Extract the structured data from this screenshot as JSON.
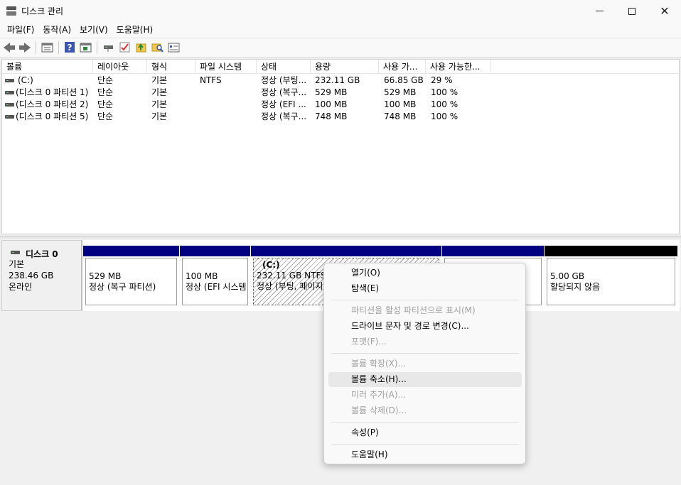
{
  "window": {
    "title": "디스크 관리"
  },
  "menu": [
    "파일(F)",
    "동작(A)",
    "보기(V)",
    "도움말(H)"
  ],
  "toolbar_icons": [
    "back-icon",
    "forward-icon",
    "properties-list-icon",
    "help-icon",
    "volume-view-icon",
    "connect-icon",
    "check-icon",
    "refresh-icon",
    "search-folder-icon",
    "settings-list-icon"
  ],
  "columns": [
    "볼륨",
    "레이아웃",
    "형식",
    "파일 시스템",
    "상태",
    "용량",
    "사용 가...",
    "사용 가능한..."
  ],
  "volumes": [
    {
      "name": "(C:)",
      "layout": "단순",
      "type": "기본",
      "fs": "NTFS",
      "status": "정상 (부팅...",
      "capacity": "232.11 GB",
      "free": "66.85 GB",
      "pct": "29 %"
    },
    {
      "name": "(디스크 0 파티션 1)",
      "layout": "단순",
      "type": "기본",
      "fs": "",
      "status": "정상 (복구...",
      "capacity": "529 MB",
      "free": "529 MB",
      "pct": "100 %"
    },
    {
      "name": "(디스크 0 파티션 2)",
      "layout": "단순",
      "type": "기본",
      "fs": "",
      "status": "정상 (EFI ...",
      "capacity": "100 MB",
      "free": "100 MB",
      "pct": "100 %"
    },
    {
      "name": "(디스크 0 파티션 5)",
      "layout": "단순",
      "type": "기본",
      "fs": "",
      "status": "정상 (복구...",
      "capacity": "748 MB",
      "free": "748 MB",
      "pct": "100 %"
    }
  ],
  "disk": {
    "name": "디스크 0",
    "type": "기본",
    "size": "238.46 GB",
    "state": "온라인"
  },
  "partitions": [
    {
      "size": "529 MB",
      "status": "정상 (복구 파티션)"
    },
    {
      "size": "100 MB",
      "status": "정상 (EFI 시스템"
    },
    {
      "label": "(C:)",
      "size": "232.11 GB NTFS",
      "status": "정상 (부팅, 페이지"
    },
    {
      "size": "",
      "status": ""
    },
    {
      "size": "5.00 GB",
      "status": "할당되지 않음"
    }
  ],
  "context_menu": {
    "open": "열기(O)",
    "explore": "탐색(E)",
    "mark_active": "파티션을 활성 파티션으로 표시(M)",
    "change_letter": "드라이브 문자 및 경로 변경(C)...",
    "format": "포맷(F)...",
    "extend": "볼륨 확장(X)...",
    "shrink": "볼륨 축소(H)...",
    "add_mirror": "미러 추가(A)...",
    "delete": "볼륨 삭제(D)...",
    "properties": "속성(P)",
    "help": "도움말(H)"
  }
}
